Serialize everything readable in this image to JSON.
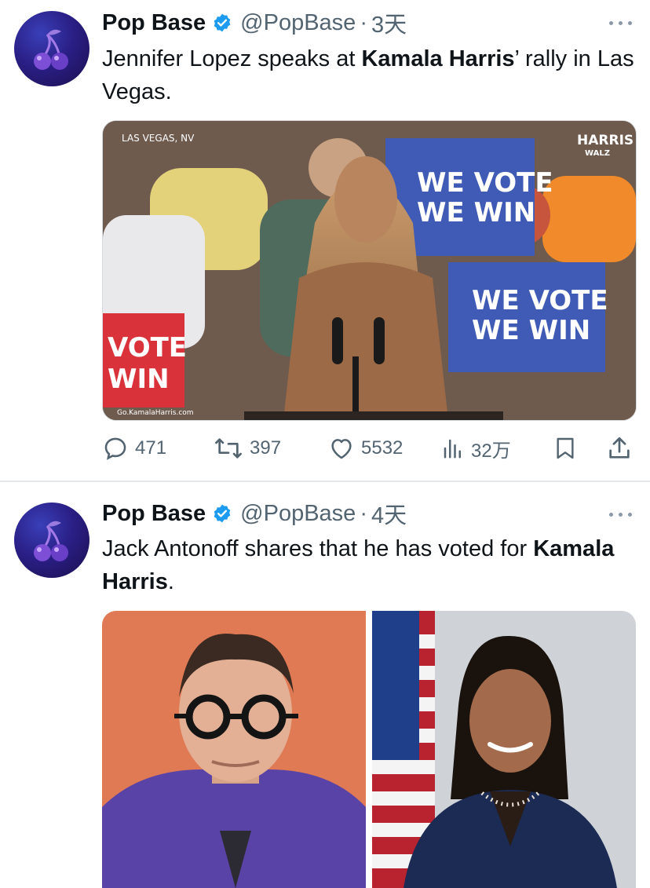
{
  "tweets": [
    {
      "author_name": "Pop Base",
      "handle": "@PopBase",
      "separator": "·",
      "time": "3天",
      "text_part1": "Jennifer Lopez speaks at ",
      "text_bold": "Kamala Harris",
      "text_part2": "’ rally in Las Vegas.",
      "media": {
        "location_caption": "LAS VEGAS, NV",
        "logo_top": "HARRIS",
        "logo_bottom": "WALZ",
        "url_caption": "Go.KamalaHarris.com",
        "sign_line1": "WE VOTE",
        "sign_line2": "WE WIN",
        "sign_left_line1": "VOTE",
        "sign_left_line2": "WIN"
      },
      "stats": {
        "replies": "471",
        "reposts": "397",
        "likes": "5532",
        "views": "32万"
      }
    },
    {
      "author_name": "Pop Base",
      "handle": "@PopBase",
      "separator": "·",
      "time": "4天",
      "text_part1": "Jack Antonoff shares that he has voted for ",
      "text_bold": "Kamala Harris",
      "text_part2": "."
    }
  ],
  "icons": {
    "verified": "verified-badge-icon",
    "more": "more-dots-icon",
    "reply": "reply-icon",
    "repost": "repost-icon",
    "like": "heart-icon",
    "views": "analytics-icon",
    "bookmark": "bookmark-icon",
    "share": "share-icon"
  },
  "colors": {
    "verified_blue": "#1d9bf0",
    "muted_text": "#536471",
    "text": "#0f1419",
    "sign_blue": "#3f5bb5",
    "sign_red": "#d9323a"
  }
}
